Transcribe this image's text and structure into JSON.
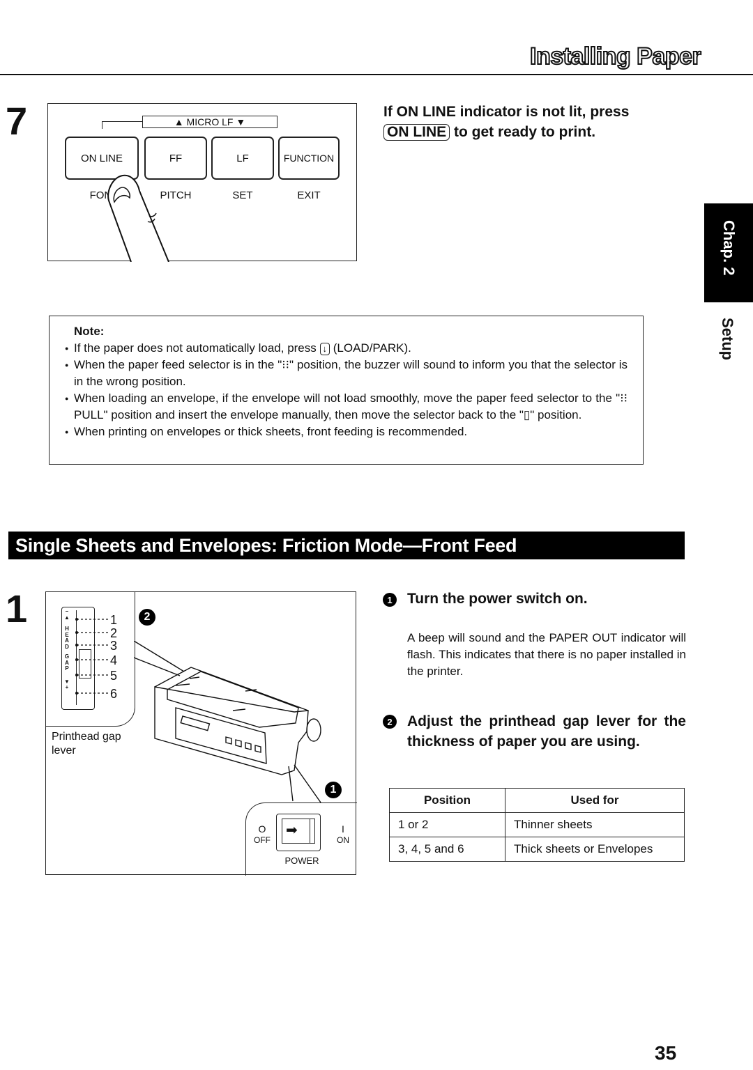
{
  "header": {
    "title": "Installing Paper"
  },
  "side_tab": {
    "chapter": "Chap. 2",
    "section": "Setup"
  },
  "step7": {
    "number": "7",
    "panel": {
      "micro_lf_label": "▲ MICRO LF ▼",
      "keys": [
        {
          "label": "ON LINE",
          "sub": "FONT"
        },
        {
          "label": "FF",
          "sub": "PITCH"
        },
        {
          "label": "LF",
          "sub": "SET"
        },
        {
          "label": "FUNCTION",
          "sub": "EXIT"
        }
      ],
      "icon": "finger-press-icon"
    },
    "instruction_part1": "If ON LINE indicator is not lit, press",
    "instruction_key": "ON LINE",
    "instruction_part2": "to get ready to print."
  },
  "note": {
    "title": "Note:",
    "items": [
      {
        "pre": "If the paper does not automatically load, press",
        "key": "↓",
        "post": "(LOAD/PARK)."
      },
      {
        "text": "When the paper feed selector is in the \"⁝⁝\" position, the buzzer will sound to inform you that the selector is in the wrong position."
      },
      {
        "text": "When loading an envelope, if the envelope will not load smoothly, move the paper feed selector to the \"⁝⁝ PULL\" position and insert the envelope manually, then move the selector back to the \"▯\" position."
      },
      {
        "text": "When printing on envelopes or thick sheets, front feeding is recommended."
      }
    ]
  },
  "section": {
    "title": "Single Sheets and Envelopes:  Friction Mode—Front Feed"
  },
  "step1": {
    "number": "1",
    "illustration": {
      "gap_lever_label_lines": [
        "Printhead gap",
        "lever"
      ],
      "gap_scale_letters": [
        "–",
        "▲",
        "H",
        "E",
        "A",
        "D",
        "G",
        "A",
        "P",
        "▼",
        "+"
      ],
      "gap_positions": [
        "1",
        "2",
        "3",
        "4",
        "5",
        "6"
      ],
      "callout_1": "1",
      "callout_2": "2",
      "power_off_symbol": "O",
      "power_off": "OFF",
      "power_on_symbol": "I",
      "power_on": "ON",
      "power_label": "POWER"
    },
    "sub1": {
      "badge": "1",
      "heading": "Turn the power switch on.",
      "body": "A beep will sound and the PAPER OUT indicator will flash. This indicates that there is no paper installed in the printer."
    },
    "sub2": {
      "badge": "2",
      "heading": "Adjust the printhead gap lever for the thickness of paper you are using."
    },
    "table": {
      "headers": [
        "Position",
        "Used for"
      ],
      "rows": [
        [
          "1 or 2",
          "Thinner sheets"
        ],
        [
          "3, 4, 5 and 6",
          "Thick sheets or Envelopes"
        ]
      ]
    }
  },
  "page_number": "35"
}
